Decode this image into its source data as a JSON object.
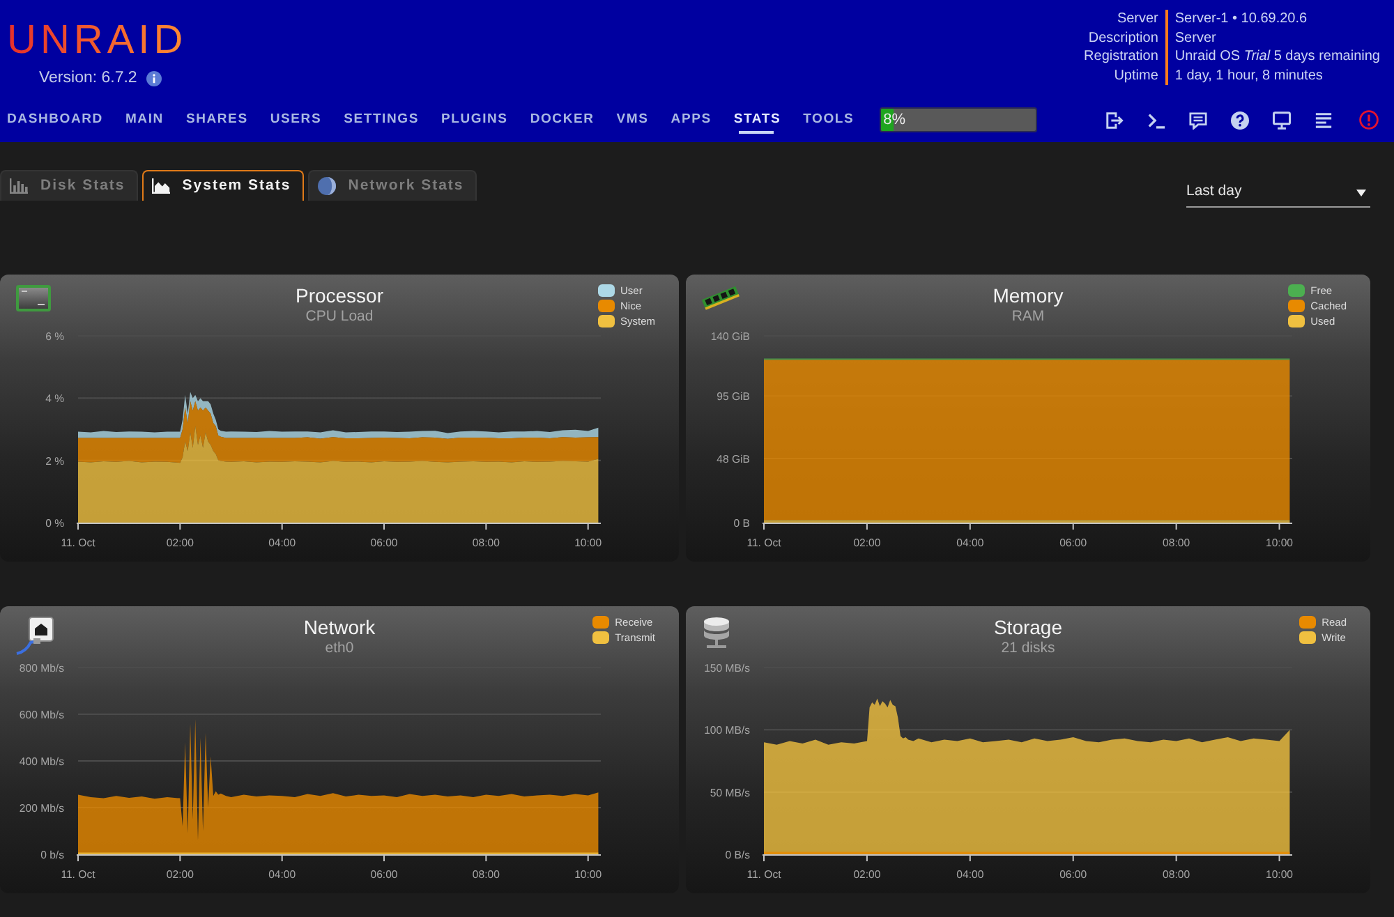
{
  "header": {
    "logo": "UNRAID",
    "version": "Version: 6.7.2",
    "info": [
      {
        "label": "Server",
        "value": "Server-1 • 10.69.20.6"
      },
      {
        "label": "Description",
        "value": "Server"
      },
      {
        "label": "Registration",
        "value": "Unraid OS *Trial* 5 days remaining"
      },
      {
        "label": "Uptime",
        "value": "1 day, 1 hour, 8 minutes"
      }
    ]
  },
  "nav": {
    "items": [
      {
        "label": "DASHBOARD",
        "selected": false
      },
      {
        "label": "MAIN",
        "selected": false
      },
      {
        "label": "SHARES",
        "selected": false
      },
      {
        "label": "USERS",
        "selected": false
      },
      {
        "label": "SETTINGS",
        "selected": false
      },
      {
        "label": "PLUGINS",
        "selected": false
      },
      {
        "label": "DOCKER",
        "selected": false
      },
      {
        "label": "VMS",
        "selected": false
      },
      {
        "label": "APPS",
        "selected": false
      },
      {
        "label": "STATS",
        "selected": true
      },
      {
        "label": "TOOLS",
        "selected": false
      }
    ],
    "load_bar": {
      "level": 0.08,
      "reading": "8%"
    }
  },
  "tabs": [
    {
      "label": "Disk Stats",
      "kind": "bars",
      "selected": false
    },
    {
      "label": "System Stats",
      "kind": "area",
      "selected": true
    },
    {
      "label": "Network Stats",
      "kind": "pie",
      "selected": false
    }
  ],
  "range_select": {
    "value": "Last day"
  },
  "panels": [
    {
      "kind": "processor",
      "chart_data": {
        "type": "area",
        "title": "Processor",
        "subtitle": "CPU Load",
        "stacked": true,
        "legend": "top-right",
        "grid": true,
        "x": [
          0,
          0.25,
          0.5,
          0.75,
          1,
          1.25,
          1.5,
          1.75,
          2,
          2.05,
          2.1,
          2.15,
          2.2,
          2.25,
          2.3,
          2.35,
          2.4,
          2.45,
          2.5,
          2.55,
          2.6,
          2.65,
          2.7,
          2.75,
          2.8,
          2.9,
          3,
          3.25,
          3.5,
          3.75,
          4,
          4.25,
          4.5,
          4.75,
          5,
          5.25,
          5.5,
          5.75,
          6,
          6.25,
          6.5,
          6.75,
          7,
          7.25,
          7.5,
          7.75,
          8,
          8.25,
          8.5,
          8.75,
          9,
          9.25,
          9.5,
          9.75,
          10,
          10.2
        ],
        "xlim": [
          0,
          10.25
        ],
        "xticks": [
          {
            "value": 0,
            "label": "11. Oct"
          },
          {
            "value": 2,
            "label": "02:00"
          },
          {
            "value": 4,
            "label": "04:00"
          },
          {
            "value": 6,
            "label": "06:00"
          },
          {
            "value": 8,
            "label": "08:00"
          },
          {
            "value": 10,
            "label": "10:00"
          }
        ],
        "ylim": [
          0,
          6
        ],
        "yticks": [
          {
            "value": 0,
            "label": "0 %"
          },
          {
            "value": 2,
            "label": "2 %"
          },
          {
            "value": 4,
            "label": "4 %"
          },
          {
            "value": 6,
            "label": "6 %"
          }
        ],
        "series": [
          {
            "name": "System",
            "color": "#f0c040",
            "values": [
              1.96,
              1.94,
              1.97,
              1.95,
              1.98,
              1.94,
              1.96,
              1.95,
              1.92,
              2.1,
              2.6,
              2.3,
              2.9,
              2.4,
              3.1,
              2.5,
              2.8,
              2.4,
              2.9,
              2.6,
              2.5,
              2.3,
              2.2,
              2.0,
              1.98,
              1.96,
              1.95,
              1.97,
              1.94,
              1.96,
              1.95,
              1.97,
              1.96,
              1.94,
              1.98,
              1.95,
              1.96,
              1.94,
              1.97,
              1.95,
              1.96,
              1.98,
              1.95,
              1.94,
              1.96,
              1.97,
              1.95,
              1.96,
              1.94,
              1.97,
              1.95,
              1.96,
              1.98,
              1.97,
              1.96,
              2.05
            ]
          },
          {
            "name": "Nice",
            "color": "#e88a00",
            "values": [
              0.76,
              0.78,
              0.75,
              0.77,
              0.74,
              0.78,
              0.76,
              0.77,
              0.8,
              0.9,
              1.1,
              0.9,
              1.0,
              1.2,
              0.8,
              1.1,
              0.9,
              1.2,
              0.8,
              1.0,
              1.0,
              0.9,
              0.9,
              0.8,
              0.78,
              0.76,
              0.77,
              0.75,
              0.78,
              0.76,
              0.77,
              0.75,
              0.78,
              0.76,
              0.77,
              0.76,
              0.75,
              0.78,
              0.76,
              0.77,
              0.75,
              0.76,
              0.78,
              0.75,
              0.77,
              0.76,
              0.78,
              0.75,
              0.77,
              0.76,
              0.78,
              0.75,
              0.77,
              0.76,
              0.78,
              0.7
            ]
          },
          {
            "name": "User",
            "color": "#add8e6",
            "values": [
              0.2,
              0.18,
              0.22,
              0.19,
              0.21,
              0.2,
              0.18,
              0.2,
              0.2,
              0.3,
              0.4,
              0.3,
              0.3,
              0.4,
              0.2,
              0.3,
              0.3,
              0.3,
              0.2,
              0.3,
              0.3,
              0.3,
              0.2,
              0.2,
              0.19,
              0.2,
              0.21,
              0.2,
              0.19,
              0.22,
              0.2,
              0.21,
              0.19,
              0.2,
              0.22,
              0.19,
              0.2,
              0.21,
              0.2,
              0.19,
              0.21,
              0.2,
              0.22,
              0.19,
              0.2,
              0.21,
              0.2,
              0.19,
              0.22,
              0.2,
              0.21,
              0.2,
              0.22,
              0.25,
              0.2,
              0.3
            ]
          }
        ]
      }
    },
    {
      "kind": "memory",
      "chart_data": {
        "type": "area",
        "title": "Memory",
        "subtitle": "RAM",
        "stacked": true,
        "legend": "top-right",
        "grid": true,
        "x": [
          0,
          2,
          4,
          6,
          8,
          10.2
        ],
        "xlim": [
          0,
          10.25
        ],
        "xticks": [
          {
            "value": 0,
            "label": "11. Oct"
          },
          {
            "value": 2,
            "label": "02:00"
          },
          {
            "value": 4,
            "label": "04:00"
          },
          {
            "value": 6,
            "label": "06:00"
          },
          {
            "value": 8,
            "label": "08:00"
          },
          {
            "value": 10,
            "label": "10:00"
          }
        ],
        "ylim": [
          0,
          140
        ],
        "yticks": [
          {
            "value": 0,
            "label": "0 B"
          },
          {
            "value": 48,
            "label": "48 GiB"
          },
          {
            "value": 95,
            "label": "95 GiB"
          },
          {
            "value": 140,
            "label": "140 GiB"
          }
        ],
        "series": [
          {
            "name": "Used",
            "color": "#f0c040",
            "values": [
              2,
              2,
              2,
              2,
              2,
              2
            ]
          },
          {
            "name": "Cached",
            "color": "#e88a00",
            "values": [
              120,
              120,
              120,
              120,
              120,
              120
            ]
          },
          {
            "name": "Free",
            "color": "#4caf50",
            "values": [
              1,
              1,
              1,
              1,
              1,
              1
            ]
          }
        ]
      }
    },
    {
      "kind": "network",
      "chart_data": {
        "type": "area",
        "title": "Network",
        "subtitle": "eth0",
        "legend": "top-right",
        "grid": true,
        "x": [
          0,
          0.25,
          0.5,
          0.75,
          1,
          1.25,
          1.5,
          1.75,
          2,
          2.05,
          2.1,
          2.15,
          2.2,
          2.25,
          2.3,
          2.35,
          2.4,
          2.45,
          2.5,
          2.55,
          2.6,
          2.65,
          2.7,
          2.75,
          2.8,
          2.9,
          3,
          3.25,
          3.5,
          3.75,
          4,
          4.25,
          4.5,
          4.75,
          5,
          5.25,
          5.5,
          5.75,
          6,
          6.25,
          6.5,
          6.75,
          7,
          7.25,
          7.5,
          7.75,
          8,
          8.25,
          8.5,
          8.75,
          9,
          9.25,
          9.5,
          9.75,
          10,
          10.2
        ],
        "xlim": [
          0,
          10.25
        ],
        "xticks": [
          {
            "value": 0,
            "label": "11. Oct"
          },
          {
            "value": 2,
            "label": "02:00"
          },
          {
            "value": 4,
            "label": "04:00"
          },
          {
            "value": 6,
            "label": "06:00"
          },
          {
            "value": 8,
            "label": "08:00"
          },
          {
            "value": 10,
            "label": "10:00"
          }
        ],
        "ylim": [
          0,
          800
        ],
        "yticks": [
          {
            "value": 0,
            "label": "0 b/s"
          },
          {
            "value": 200,
            "label": "200 Mb/s"
          },
          {
            "value": 400,
            "label": "400 Mb/s"
          },
          {
            "value": 600,
            "label": "600 Mb/s"
          },
          {
            "value": 800,
            "label": "800 Mb/s"
          }
        ],
        "series": [
          {
            "name": "Receive",
            "color": "#e88a00",
            "values": [
              255,
              245,
              240,
              250,
              242,
              248,
              238,
              245,
              240,
              120,
              480,
              90,
              560,
              150,
              580,
              60,
              500,
              100,
              520,
              200,
              420,
              250,
              270,
              255,
              260,
              250,
              245,
              255,
              248,
              252,
              250,
              245,
              258,
              250,
              262,
              248,
              255,
              250,
              252,
              245,
              258,
              250,
              255,
              248,
              252,
              245,
              255,
              250,
              258,
              248,
              252,
              255,
              250,
              258,
              252,
              265
            ]
          },
          {
            "name": "Transmit",
            "color": "#f0c040",
            "values": [
              8,
              8,
              8,
              8,
              8,
              8,
              8,
              8,
              8,
              8,
              8,
              8,
              8,
              8,
              8,
              8,
              8,
              8,
              8,
              8,
              8,
              8,
              8,
              8,
              8,
              8,
              8,
              8,
              8,
              8,
              8,
              8,
              8,
              8,
              8,
              8,
              8,
              8,
              8,
              8,
              8,
              8,
              8,
              8,
              8,
              8,
              8,
              8,
              8,
              8,
              8,
              8,
              8,
              8,
              8,
              8
            ]
          }
        ]
      }
    },
    {
      "kind": "storage",
      "chart_data": {
        "type": "area",
        "title": "Storage",
        "subtitle": "21 disks",
        "legend": "top-right",
        "grid": true,
        "x": [
          0,
          0.25,
          0.5,
          0.75,
          1,
          1.25,
          1.5,
          1.75,
          2,
          2.05,
          2.1,
          2.15,
          2.2,
          2.25,
          2.3,
          2.35,
          2.4,
          2.45,
          2.5,
          2.55,
          2.6,
          2.65,
          2.7,
          2.75,
          2.8,
          2.9,
          3,
          3.25,
          3.5,
          3.75,
          4,
          4.25,
          4.5,
          4.75,
          5,
          5.25,
          5.5,
          5.75,
          6,
          6.25,
          6.5,
          6.75,
          7,
          7.25,
          7.5,
          7.75,
          8,
          8.25,
          8.5,
          8.75,
          9,
          9.25,
          9.5,
          9.75,
          10,
          10.2
        ],
        "xlim": [
          0,
          10.25
        ],
        "xticks": [
          {
            "value": 0,
            "label": "11. Oct"
          },
          {
            "value": 2,
            "label": "02:00"
          },
          {
            "value": 4,
            "label": "04:00"
          },
          {
            "value": 6,
            "label": "06:00"
          },
          {
            "value": 8,
            "label": "08:00"
          },
          {
            "value": 10,
            "label": "10:00"
          }
        ],
        "ylim": [
          0,
          150
        ],
        "yticks": [
          {
            "value": 0,
            "label": "0 B/s"
          },
          {
            "value": 50,
            "label": "50 MB/s"
          },
          {
            "value": 100,
            "label": "100 MB/s"
          },
          {
            "value": 150,
            "label": "150 MB/s"
          }
        ],
        "series": [
          {
            "name": "Read",
            "color": "#e88a00",
            "values": [
              2,
              2,
              2,
              2,
              2,
              2,
              2,
              2,
              2,
              2,
              2,
              2,
              2,
              2,
              2,
              2,
              2,
              2,
              2,
              2,
              2,
              2,
              2,
              2,
              2,
              2,
              2,
              2,
              2,
              2,
              2,
              2,
              2,
              2,
              2,
              2,
              2,
              2,
              2,
              2,
              2,
              2,
              2,
              2,
              2,
              2,
              2,
              2,
              2,
              2,
              2,
              2,
              2,
              2,
              2,
              2
            ]
          },
          {
            "name": "Write",
            "color": "#f0c040",
            "values": [
              90,
              88,
              91,
              89,
              92,
              88,
              90,
              89,
              91,
              118,
              122,
              120,
              125,
              119,
              123,
              121,
              118,
              124,
              120,
              119,
              110,
              95,
              93,
              94,
              92,
              91,
              93,
              90,
              92,
              91,
              93,
              90,
              91,
              92,
              90,
              93,
              91,
              92,
              94,
              91,
              90,
              92,
              93,
              91,
              90,
              92,
              91,
              93,
              90,
              92,
              94,
              91,
              93,
              92,
              91,
              100
            ]
          }
        ]
      }
    }
  ]
}
